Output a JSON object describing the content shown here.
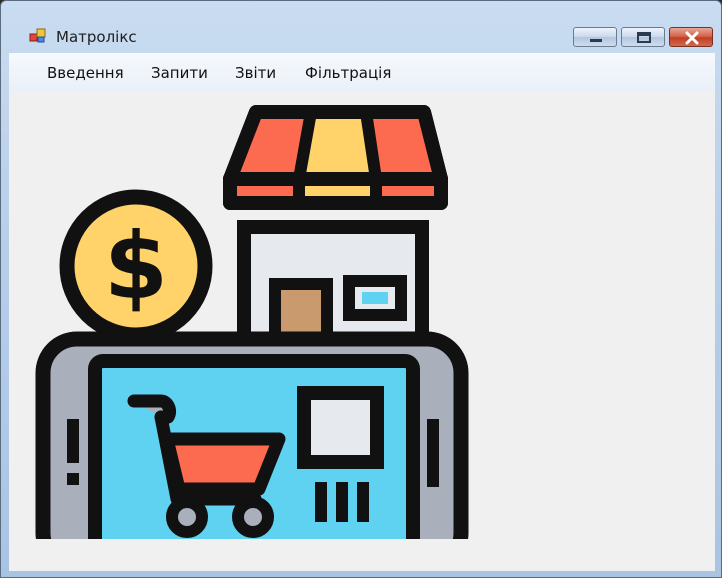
{
  "window": {
    "title": "Матролікс"
  },
  "menu": {
    "items": [
      {
        "label": "Введення"
      },
      {
        "label": "Запити"
      },
      {
        "label": "Звіти"
      },
      {
        "label": "Фільтрація"
      }
    ]
  },
  "icons": {
    "app": "app-window-icon",
    "minimize": "minimize-icon",
    "maximize": "maximize-icon",
    "close": "close-icon",
    "illustration": "online-shop-smartphone-icon"
  },
  "colors": {
    "awning_red": "#fc6b50",
    "awning_yellow": "#ffd36a",
    "coin_yellow": "#ffd36a",
    "screen_blue": "#5fd2f2",
    "phone_grey": "#a9b0bb",
    "door_brown": "#c99a6e",
    "cart_red": "#fc6b50",
    "outline": "#111111"
  }
}
